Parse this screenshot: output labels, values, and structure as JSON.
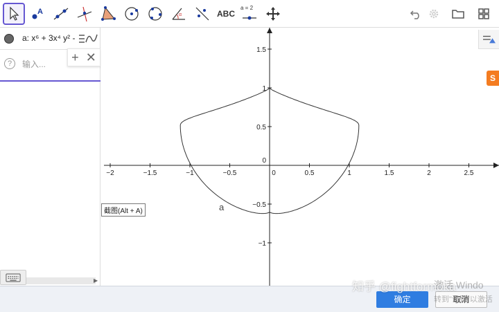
{
  "toolbar": {
    "tools": [
      {
        "name": "move-tool"
      },
      {
        "name": "point-tool"
      },
      {
        "name": "line-tool"
      },
      {
        "name": "perpendicular-line-tool"
      },
      {
        "name": "polygon-tool"
      },
      {
        "name": "circle-center-tool"
      },
      {
        "name": "circle-three-points-tool"
      },
      {
        "name": "angle-tool"
      },
      {
        "name": "reflect-tool"
      },
      {
        "name": "text-tool",
        "label": "ABC"
      },
      {
        "name": "slider-tool",
        "label": "a = 2"
      },
      {
        "name": "move-graphics-view-tool"
      }
    ],
    "right_icons": [
      "undo-icon",
      "settings-icon",
      "folder-icon",
      "perspectives-icon"
    ]
  },
  "algebra": {
    "expression": "a: x⁶ + 3x⁴ y² - ",
    "input_placeholder": "输入..."
  },
  "graphics": {
    "x_ticks": [
      "−2",
      "−1.5",
      "−1",
      "−0.5",
      "0",
      "0.5",
      "1",
      "1.5",
      "2",
      "2.5"
    ],
    "y_ticks": [
      "1.5",
      "1",
      "0.5",
      "0",
      "−0.5",
      "−1"
    ],
    "curve_label": "a",
    "orange_tab_label": "S"
  },
  "tooltip": "截图(Alt + A)",
  "dialog": {
    "ok_label": "确定",
    "cancel_label": "取消"
  },
  "watermark": "知乎 @fightformoka",
  "windows_watermark": {
    "line1": "激活 Windo",
    "line2": "转到\"设置\"以激活"
  }
}
